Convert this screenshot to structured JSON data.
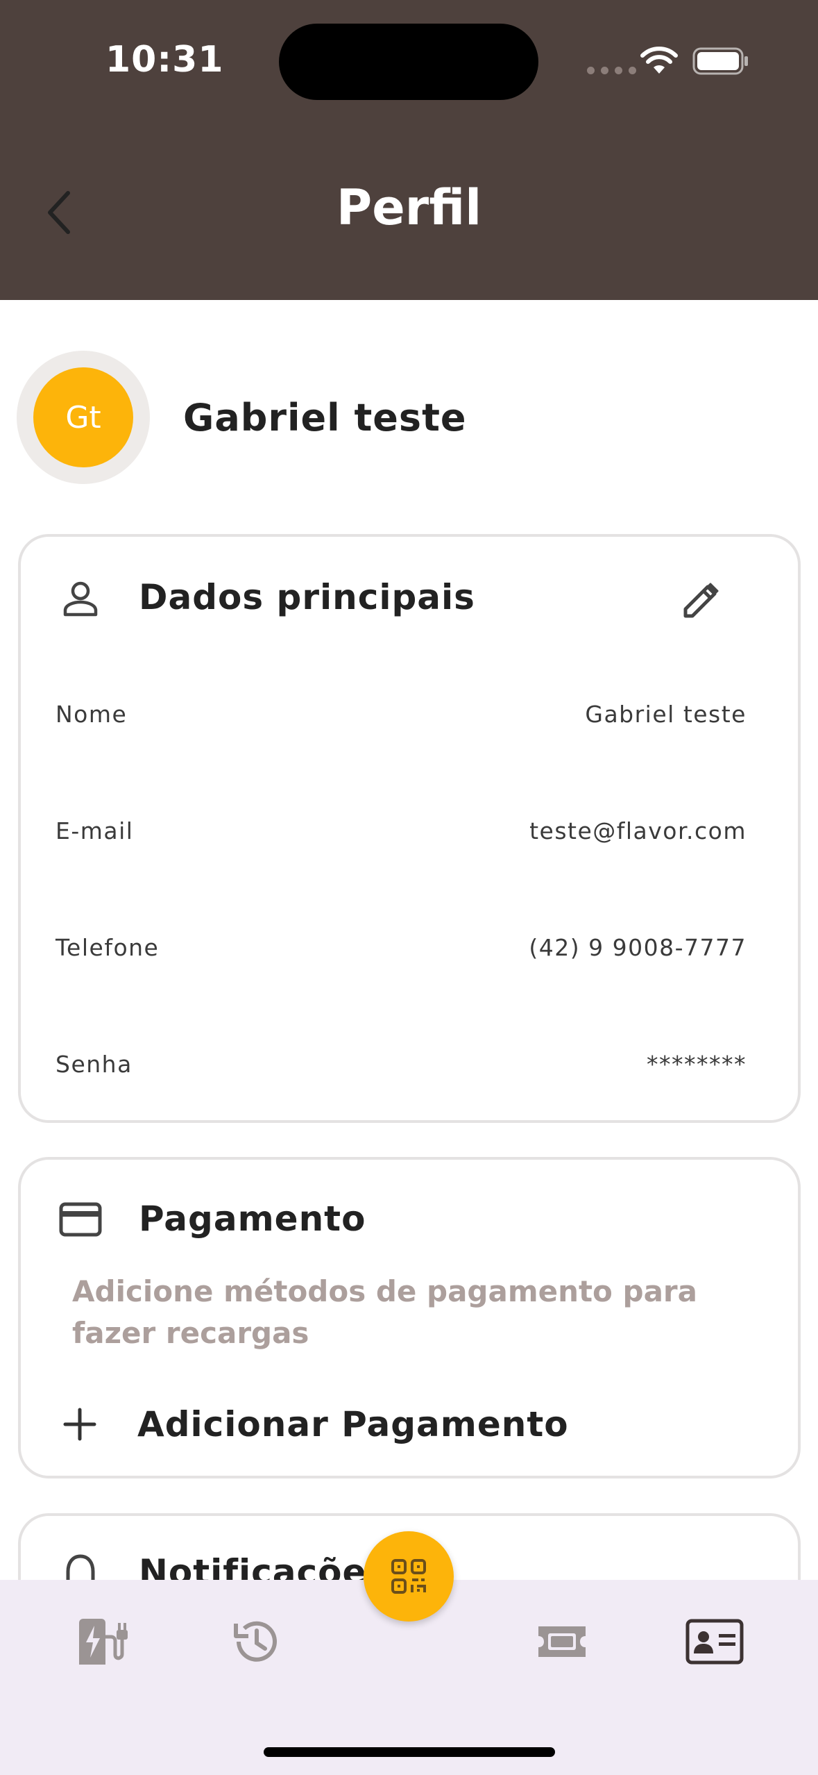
{
  "status_bar": {
    "time": "10:31"
  },
  "header": {
    "title": "Perfil",
    "back_icon": "chevron-left-icon"
  },
  "profile": {
    "initials": "Gt",
    "name": "Gabriel teste",
    "avatar_color": "#fdb40a"
  },
  "main_data": {
    "title": "Dados principais",
    "icon": "person-icon",
    "edit_icon": "pencil-icon",
    "rows": [
      {
        "label": "Nome",
        "value": "Gabriel teste"
      },
      {
        "label": "E-mail",
        "value": "teste@flavor.com"
      },
      {
        "label": "Telefone",
        "value": "(42) 9 9008-7777"
      },
      {
        "label": "Senha",
        "value": "********"
      }
    ]
  },
  "payment": {
    "title": "Pagamento",
    "icon": "credit-card-icon",
    "hint": "Adicione métodos de pagamento para fazer recargas",
    "add_label": "Adicionar Pagamento"
  },
  "notifications": {
    "title": "Notificações",
    "icon": "bell-icon"
  },
  "bottom_nav": {
    "items": [
      {
        "name": "charging-station",
        "icon": "ev-charger-icon"
      },
      {
        "name": "history",
        "icon": "history-icon"
      },
      {
        "name": "qr-scan",
        "icon": "qr-code-icon"
      },
      {
        "name": "vouchers",
        "icon": "ticket-icon"
      },
      {
        "name": "profile",
        "icon": "id-card-icon",
        "active": true
      }
    ]
  },
  "colors": {
    "header_bg": "#4e413d",
    "accent": "#fdb40a",
    "nav_bg": "#f1ebf5",
    "hint_text": "#ac9f9c"
  }
}
